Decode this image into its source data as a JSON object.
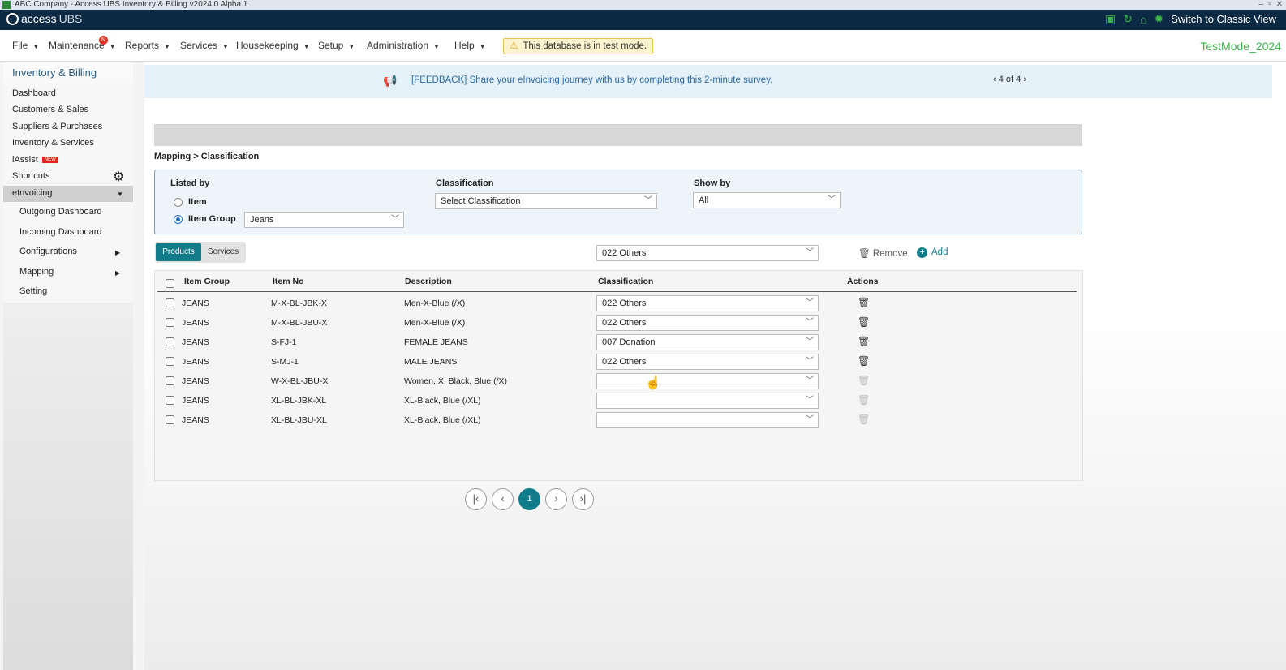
{
  "window": {
    "title": "ABC Company - Access UBS Inventory & Billing v2024.0 Alpha 1"
  },
  "topbar": {
    "brand_access": "access",
    "brand_ubs": "UBS",
    "switch_label": "Switch to Classic View"
  },
  "menu": {
    "items": [
      "File",
      "Maintenance",
      "Reports",
      "Services",
      "Housekeeping",
      "Setup",
      "Administration",
      "Help"
    ],
    "maintenance_badge": "N",
    "test_mode_notice": "This database is in test mode.",
    "db_name": "TestMode_2024"
  },
  "sidebar": {
    "title": "Inventory & Billing",
    "items": [
      "Dashboard",
      "Customers & Sales",
      "Suppliers & Purchases",
      "Inventory & Services",
      "iAssist",
      "Shortcuts",
      "eInvoicing"
    ],
    "iassist_badge": "NEW",
    "einvoicing_sub": [
      "Outgoing Dashboard",
      "Incoming Dashboard",
      "Configurations",
      "Mapping",
      "Setting"
    ]
  },
  "feedback": {
    "text": "[FEEDBACK] Share your eInvoicing journey with us by completing this 2-minute survey.",
    "pager": "4 of 4"
  },
  "breadcrumb": "Mapping > Classification",
  "filters": {
    "listed_by_label": "Listed by",
    "option_item": "Item",
    "option_item_group": "Item Group",
    "item_group_value": "Jeans",
    "classification_label": "Classification",
    "classification_placeholder": "Select Classification",
    "show_by_label": "Show by",
    "show_by_value": "All"
  },
  "tabs": {
    "products": "Products",
    "services": "Services"
  },
  "bulk": {
    "classification_value": "022 Others",
    "remove_label": "Remove",
    "add_label": "Add"
  },
  "table": {
    "headers": [
      "Item Group",
      "Item No",
      "Description",
      "Classification",
      "Actions"
    ],
    "rows": [
      {
        "group": "JEANS",
        "item_no": "M-X-BL-JBK-X",
        "desc": "Men-X-Blue (/X)",
        "class": "022 Others"
      },
      {
        "group": "JEANS",
        "item_no": "M-X-BL-JBU-X",
        "desc": "Men-X-Blue (/X)",
        "class": "022 Others"
      },
      {
        "group": "JEANS",
        "item_no": "S-FJ-1",
        "desc": "FEMALE JEANS",
        "class": "007 Donation"
      },
      {
        "group": "JEANS",
        "item_no": "S-MJ-1",
        "desc": "MALE JEANS",
        "class": "022 Others"
      },
      {
        "group": "JEANS",
        "item_no": "W-X-BL-JBU-X",
        "desc": "Women, X, Black, Blue (/X)",
        "class": ""
      },
      {
        "group": "JEANS",
        "item_no": "XL-BL-JBK-XL",
        "desc": "XL-Black, Blue (/XL)",
        "class": ""
      },
      {
        "group": "JEANS",
        "item_no": "XL-BL-JBU-XL",
        "desc": "XL-Black, Blue (/XL)",
        "class": ""
      }
    ]
  },
  "pagination": {
    "current": "1"
  },
  "colors": {
    "accent": "#127d8a",
    "topbar": "#0d2a45",
    "test_green": "#3bb54a"
  },
  "icons": [
    "save-icon",
    "refresh-icon",
    "home-icon",
    "gear-icon",
    "warning-icon",
    "megaphone-icon",
    "trash-icon",
    "plus-circle-icon",
    "chevron-down-icon"
  ]
}
